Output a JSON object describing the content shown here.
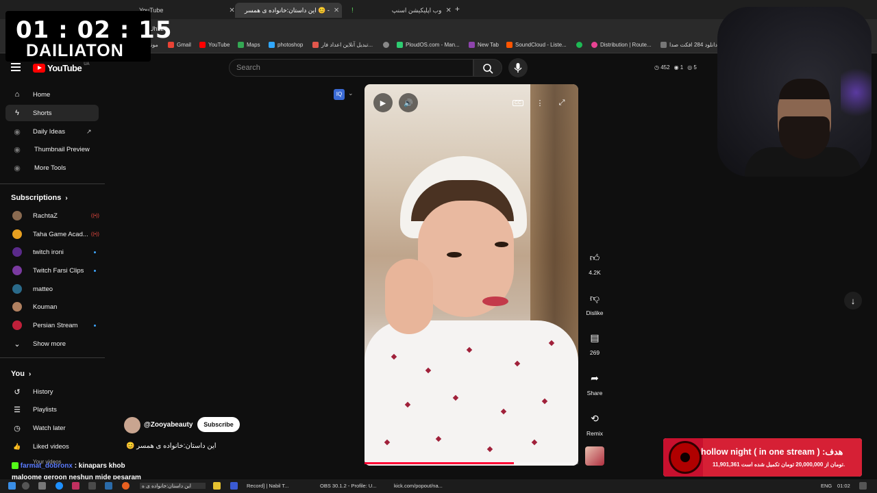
{
  "browser": {
    "tabs": [
      {
        "label": "YouTube",
        "active": false
      },
      {
        "label": "این داستان:خانواده ی همسر 😊 -",
        "active": true
      },
      {
        "label": "وب اپلیکیشن اسنپ",
        "active": false
      }
    ],
    "new_tab": "+",
    "url": "Uh1z4",
    "bookmarks": [
      {
        "label": "موند",
        "color": "#4a8af4"
      },
      {
        "label": "Gmail",
        "color": "#ea4335"
      },
      {
        "label": "YouTube",
        "color": "#ff0000"
      },
      {
        "label": "Maps",
        "color": "#34a853"
      },
      {
        "label": "photoshop",
        "color": "#31a8ff"
      },
      {
        "label": "تبدیل آنلاین اعداد فار...",
        "color": "#e2574c"
      },
      {
        "label": "",
        "color": "#888888"
      },
      {
        "label": "PloudOS.com - Man...",
        "color": "#2ecc71"
      },
      {
        "label": "New Tab",
        "color": "#8e44ad"
      },
      {
        "label": "SoundCloud - Liste...",
        "color": "#ff5500"
      },
      {
        "label": "",
        "color": "#1db954"
      },
      {
        "label": "Distribution | Route...",
        "color": "#e84393"
      },
      {
        "label": "دانلود 284 افکت صدا...",
        "color": "#777777"
      }
    ]
  },
  "timer": {
    "time": "01 : 02 : 15",
    "label": "DAILIATON"
  },
  "youtube": {
    "logo_text": "YouTube",
    "logo_country": "UA",
    "search_placeholder": "Search",
    "stats": {
      "a": "452",
      "b": "1",
      "c": "5"
    }
  },
  "sidebar": {
    "main": [
      {
        "label": "Home",
        "icon": "home-icon",
        "glyph": "⌂"
      },
      {
        "label": "Shorts",
        "icon": "shorts-icon",
        "glyph": "ϟ"
      },
      {
        "label": "Daily Ideas",
        "icon": "ideas-icon",
        "glyph": "◉"
      },
      {
        "label": "Thumbnail Preview",
        "icon": "thumbnail-icon",
        "glyph": "◉"
      },
      {
        "label": "More Tools",
        "icon": "tools-icon",
        "glyph": "◉"
      }
    ],
    "subscriptions_title": "Subscriptions",
    "subscriptions": [
      {
        "label": "RachtaZ",
        "color": "#8a6a50",
        "badge": "live"
      },
      {
        "label": "Taha Game Acad...",
        "color": "#e8a020",
        "badge": "live"
      },
      {
        "label": "twitch ironi",
        "color": "#5a2a8a",
        "badge": "dot"
      },
      {
        "label": "Twitch Farsi Clips",
        "color": "#7a3aa0",
        "badge": "dot"
      },
      {
        "label": "matteo",
        "color": "#2a6a8a",
        "badge": ""
      },
      {
        "label": "Kouman",
        "color": "#b08060",
        "badge": ""
      },
      {
        "label": "Persian Stream",
        "color": "#c0203a",
        "badge": "dot"
      }
    ],
    "show_more": "Show more",
    "you_title": "You",
    "you": [
      {
        "label": "History",
        "icon": "history-icon",
        "glyph": "↺"
      },
      {
        "label": "Playlists",
        "icon": "playlists-icon",
        "glyph": "☰"
      },
      {
        "label": "Watch later",
        "icon": "watch-later-icon",
        "glyph": "◷"
      },
      {
        "label": "Liked videos",
        "icon": "liked-icon",
        "glyph": "👍"
      },
      {
        "label": "Your videos",
        "icon": "your-videos-icon",
        "glyph": "▶"
      }
    ]
  },
  "video": {
    "channel": "@Zooyabeauty",
    "subscribe": "Subscribe",
    "title": "این داستان:خانواده ی همسر 😊",
    "progress": 0.7
  },
  "actions": {
    "like": "4.2K",
    "dislike": "Dislike",
    "comments": "269",
    "share": "Share",
    "remix": "Remix"
  },
  "chat": {
    "user": "farmat_dobronx",
    "message1": ": kinapars khob",
    "message2": "maloome geroon neshun mide pesaram"
  },
  "donation": {
    "title": "hollow night ( in one stream ) :هدف",
    "subtitle": "11,901,361 تومان از 20,000,000 تومان تکمیل شده است."
  },
  "taskbar": {
    "items": [
      "این داستان:خانواده ی ه",
      "Record] | Nabil T...",
      "OBS 30.1.2 - Profile: U...",
      "kick.com/popout/na..."
    ],
    "lang": "ENG",
    "clock": "01:02"
  }
}
